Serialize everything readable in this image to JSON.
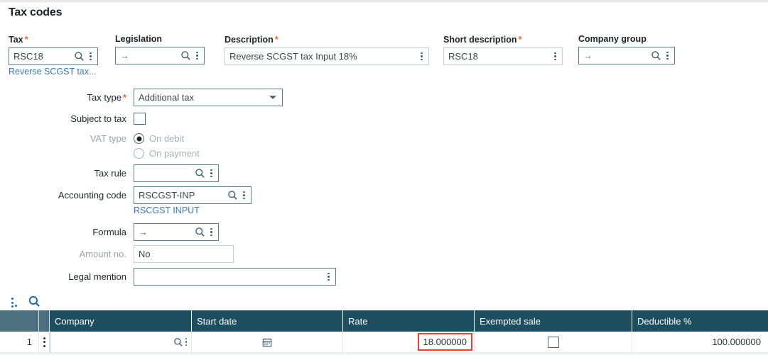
{
  "page": {
    "title": "Tax codes"
  },
  "header_fields": [
    {
      "label": "Tax",
      "required": true,
      "value": "RSC18",
      "placeholder": "",
      "sublink": "Reverse SCGST tax...",
      "icons": [
        "search-icon",
        "kebab-icon"
      ],
      "style": "teal"
    },
    {
      "label": "Legislation",
      "required": false,
      "value": "",
      "arrow": "→",
      "icons": [
        "search-icon",
        "kebab-icon"
      ],
      "style": "teal"
    },
    {
      "label": "Description",
      "required": true,
      "value": "Reverse SCGST tax Input 18%",
      "icons": [
        "kebab-icon"
      ],
      "style": "light"
    },
    {
      "label": "Short description",
      "required": true,
      "value": "RSC18",
      "icons": [
        "kebab-icon"
      ],
      "style": "light"
    },
    {
      "label": "Company group",
      "required": false,
      "value": "",
      "arrow": "→",
      "icons": [
        "search-icon",
        "kebab-icon"
      ],
      "style": "teal"
    }
  ],
  "form": {
    "tax_type": {
      "label": "Tax type",
      "required": true,
      "value": "Additional tax",
      "options": [
        "Additional tax"
      ]
    },
    "subject_to_tax": {
      "label": "Subject to tax",
      "checked": false
    },
    "vat_type": {
      "label": "VAT type",
      "disabled": true,
      "options": [
        {
          "label": "On debit",
          "selected": true
        },
        {
          "label": "On payment",
          "selected": false
        }
      ]
    },
    "tax_rule": {
      "label": "Tax rule",
      "value": ""
    },
    "accounting_code": {
      "label": "Accounting code",
      "value": "RSCGST-INP",
      "sublink": "RSCGST INPUT"
    },
    "formula": {
      "label": "Formula",
      "value": "",
      "arrow": "→"
    },
    "amount_no": {
      "label": "Amount no.",
      "value": "No",
      "disabled": true
    },
    "legal_mention": {
      "label": "Legal mention",
      "value": ""
    }
  },
  "grid": {
    "toolbar": {
      "actions_icon": "kebab-menu-icon",
      "search_icon": "search-icon"
    },
    "columns": [
      "",
      "",
      "Company",
      "Start date",
      "Rate",
      "Exempted sale",
      "Deductible %"
    ],
    "rows": [
      {
        "index": "1",
        "company": "",
        "start_date": "",
        "rate": "18.000000",
        "rate_highlighted": true,
        "exempted_sale": false,
        "deductible_pct": "100.000000"
      }
    ]
  },
  "colors": {
    "grid_header": "#1d4e5f",
    "grid_header_pale": "#4d6f80",
    "required_star": "#f26722",
    "link": "#3a7ab5",
    "highlight_border": "#e8412f",
    "field_border_teal": "#5a7c8c",
    "field_border_light": "#c3ccd2"
  }
}
